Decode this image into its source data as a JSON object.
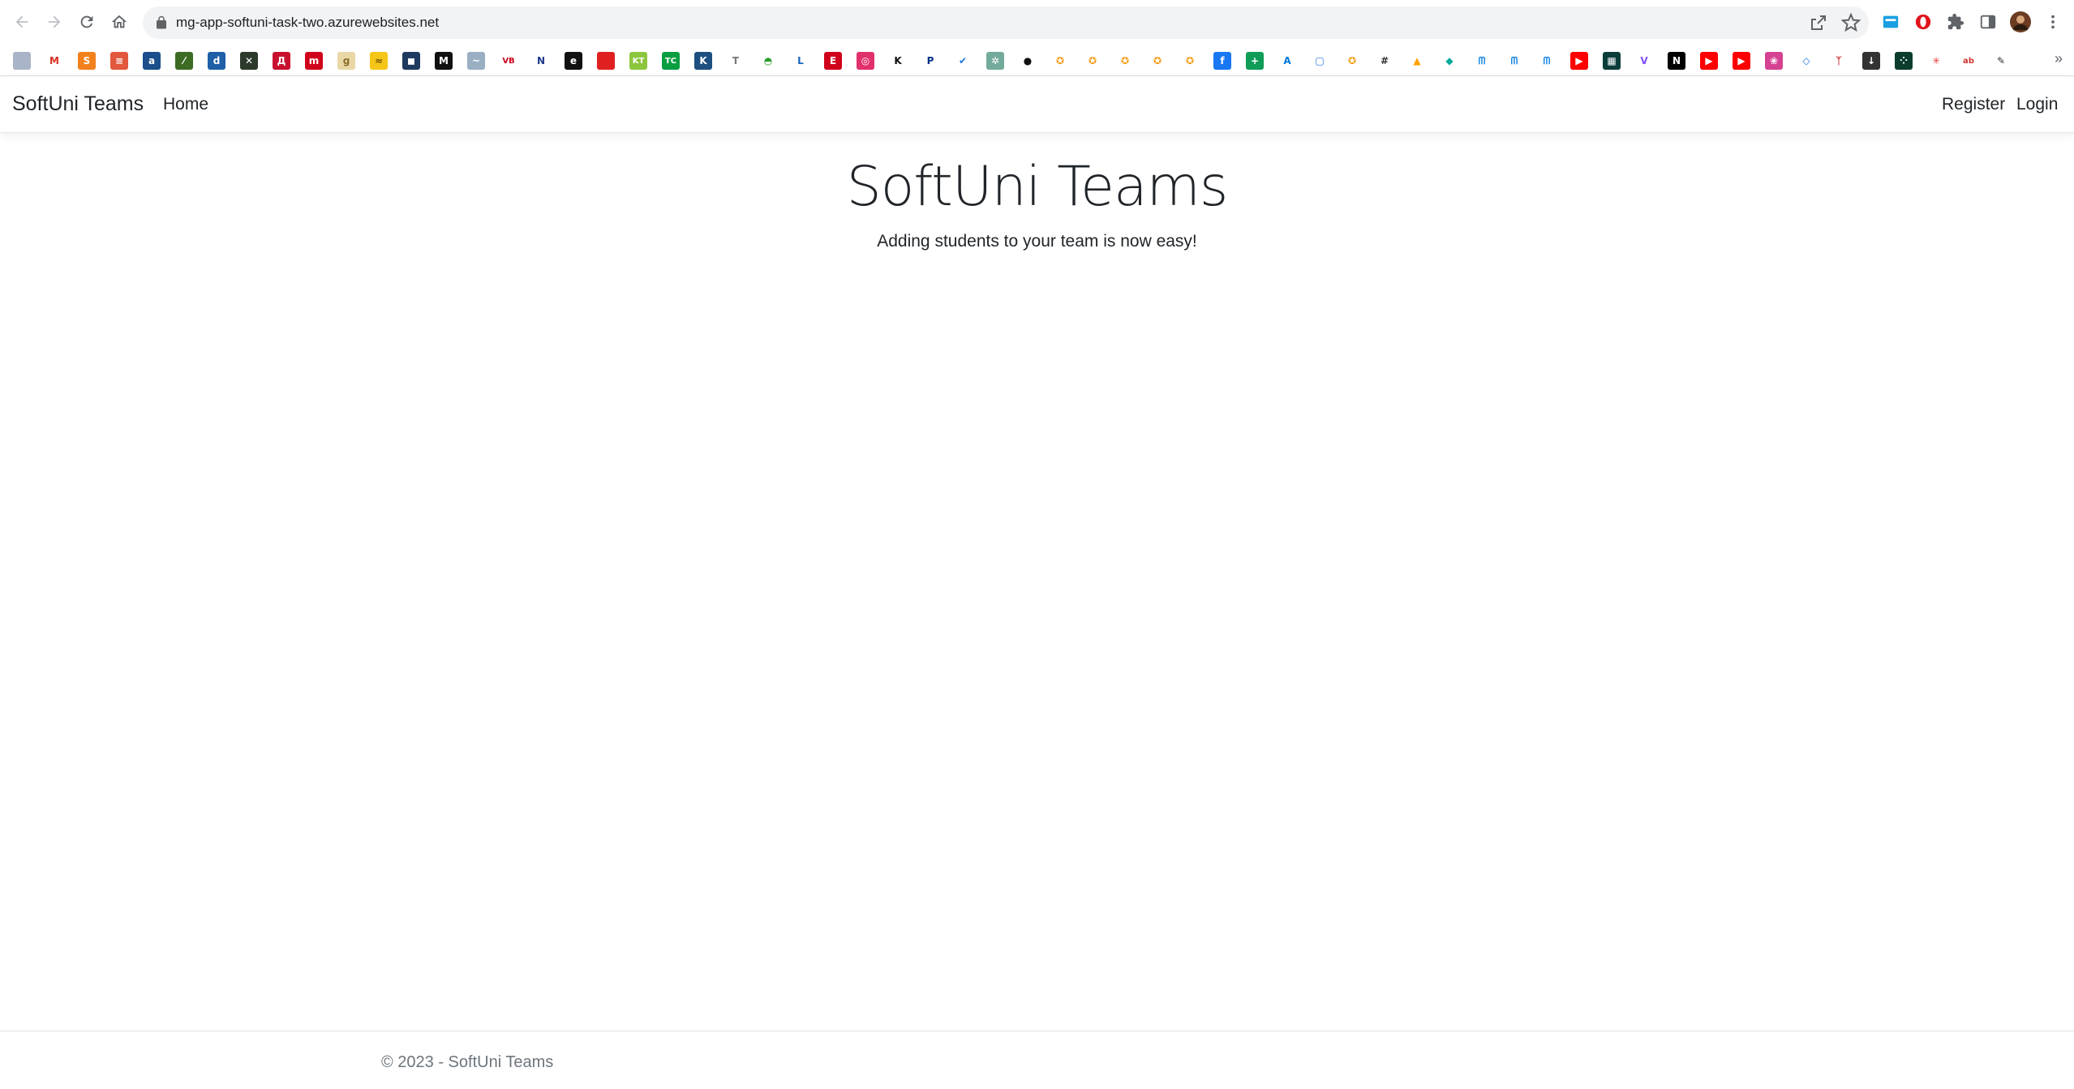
{
  "browser": {
    "url": "mg-app-softuni-task-two.azurewebsites.net",
    "bookmarks": [
      {
        "icon": "doc-icon",
        "color": "#aab4c8",
        "glyph": ""
      },
      {
        "icon": "gmail-icon",
        "color": "#ffffff",
        "glyph": "M"
      },
      {
        "icon": "orange-s-icon",
        "color": "#f2811d",
        "glyph": "S"
      },
      {
        "icon": "news-icon",
        "color": "#e2583e",
        "glyph": "≡"
      },
      {
        "icon": "a-icon",
        "color": "#1b4e8b",
        "glyph": "a"
      },
      {
        "icon": "leaf-icon",
        "color": "#3d6b24",
        "glyph": "⁄"
      },
      {
        "icon": "dir-icon",
        "color": "#1e5fa8",
        "glyph": "d"
      },
      {
        "icon": "x-circle-icon",
        "color": "#2b3a2b",
        "glyph": "✕"
      },
      {
        "icon": "red-book-icon",
        "color": "#c8102e",
        "glyph": "Д"
      },
      {
        "icon": "m-icon",
        "color": "#d0021b",
        "glyph": "m"
      },
      {
        "icon": "g-icon",
        "color": "#e9d8a6",
        "glyph": "g"
      },
      {
        "icon": "yellow-icon",
        "color": "#f5c518",
        "glyph": "≈"
      },
      {
        "icon": "dark-icon",
        "color": "#1e3a5f",
        "glyph": "◼"
      },
      {
        "icon": "jm-icon",
        "color": "#111111",
        "glyph": "M"
      },
      {
        "icon": "wave-icon",
        "color": "#9aaec4",
        "glyph": "~"
      },
      {
        "icon": "vb-icon",
        "color": "#ffffff",
        "glyph": "VB"
      },
      {
        "icon": "n-icon",
        "color": "#ffffff",
        "glyph": "N"
      },
      {
        "icon": "e-dark-icon",
        "color": "#111111",
        "glyph": "e"
      },
      {
        "icon": "red-square-icon",
        "color": "#e02020",
        "glyph": ""
      },
      {
        "icon": "kt-icon",
        "color": "#8cc63f",
        "glyph": "KT"
      },
      {
        "icon": "tc-icon",
        "color": "#0a9e41",
        "glyph": "TC"
      },
      {
        "icon": "k-icon",
        "color": "#1d4f80",
        "glyph": "K"
      },
      {
        "icon": "t-icon",
        "color": "#ffffff",
        "glyph": "T"
      },
      {
        "icon": "car-icon",
        "color": "#ffffff",
        "glyph": "◓"
      },
      {
        "icon": "l-icon",
        "color": "#ffffff",
        "glyph": "L"
      },
      {
        "icon": "e-red-icon",
        "color": "#d0021b",
        "glyph": "E"
      },
      {
        "icon": "instagram-icon",
        "color": "#e1306c",
        "glyph": "◎"
      },
      {
        "icon": "k-bold-icon",
        "color": "#ffffff",
        "glyph": "K"
      },
      {
        "icon": "paypal-icon",
        "color": "#ffffff",
        "glyph": "P"
      },
      {
        "icon": "check-icon",
        "color": "#ffffff",
        "glyph": "✔"
      },
      {
        "icon": "chatgpt-icon",
        "color": "#74aa9c",
        "glyph": "✲"
      },
      {
        "icon": "github-icon",
        "color": "#ffffff",
        "glyph": "●"
      },
      {
        "icon": "softuni-icon",
        "color": "#ffffff",
        "glyph": "✪"
      },
      {
        "icon": "softuni-icon",
        "color": "#ffffff",
        "glyph": "✪"
      },
      {
        "icon": "softuni-icon",
        "color": "#ffffff",
        "glyph": "✪"
      },
      {
        "icon": "softuni-icon",
        "color": "#ffffff",
        "glyph": "✪"
      },
      {
        "icon": "softuni-icon",
        "color": "#ffffff",
        "glyph": "✪"
      },
      {
        "icon": "facebook-icon",
        "color": "#1877f2",
        "glyph": "f"
      },
      {
        "icon": "sheets-icon",
        "color": "#0f9d58",
        "glyph": "+"
      },
      {
        "icon": "azure-icon",
        "color": "#ffffff",
        "glyph": "A"
      },
      {
        "icon": "frame-icon",
        "color": "#ffffff",
        "glyph": "▢"
      },
      {
        "icon": "softuni-icon",
        "color": "#ffffff",
        "glyph": "✪"
      },
      {
        "icon": "hash-icon",
        "color": "#ffffff",
        "glyph": "#"
      },
      {
        "icon": "firebase-icon",
        "color": "#ffffff",
        "glyph": "▲"
      },
      {
        "icon": "diamond-icon",
        "color": "#ffffff",
        "glyph": "◆"
      },
      {
        "icon": "mj-icon",
        "color": "#ffffff",
        "glyph": "ᗰ"
      },
      {
        "icon": "mj-icon",
        "color": "#ffffff",
        "glyph": "ᗰ"
      },
      {
        "icon": "mj-icon",
        "color": "#ffffff",
        "glyph": "ᗰ"
      },
      {
        "icon": "youtube-icon",
        "color": "#ff0000",
        "glyph": "▶"
      },
      {
        "icon": "grid-icon",
        "color": "#0b3d3a",
        "glyph": "▦"
      },
      {
        "icon": "vue-icon",
        "color": "#ffffff",
        "glyph": "V"
      },
      {
        "icon": "nextjs-icon",
        "color": "#000000",
        "glyph": "N"
      },
      {
        "icon": "youtube-icon",
        "color": "#ff0000",
        "glyph": "▶"
      },
      {
        "icon": "youtube-icon",
        "color": "#ff0000",
        "glyph": "▶"
      },
      {
        "icon": "swirl-icon",
        "color": "#d64292",
        "glyph": "❀"
      },
      {
        "icon": "diamond-outline-icon",
        "color": "#ffffff",
        "glyph": "◇"
      },
      {
        "icon": "tree-icon",
        "color": "#ffffff",
        "glyph": "ᛉ"
      },
      {
        "icon": "download-icon",
        "color": "#333333",
        "glyph": "↓"
      },
      {
        "icon": "dots-icon",
        "color": "#0b3d2e",
        "glyph": "⁘"
      },
      {
        "icon": "asterisk-icon",
        "color": "#ffffff",
        "glyph": "✳"
      },
      {
        "icon": "ab-icon",
        "color": "#ffffff",
        "glyph": "ab"
      },
      {
        "icon": "pencil-icon",
        "color": "#ffffff",
        "glyph": "✎"
      }
    ]
  },
  "navbar": {
    "brand": "SoftUni Teams",
    "links": [
      {
        "label": "Home"
      }
    ],
    "right_links": [
      {
        "label": "Register"
      },
      {
        "label": "Login"
      }
    ]
  },
  "hero": {
    "title": "SoftUni Teams",
    "subtitle": "Adding students to your team is now easy!"
  },
  "footer": {
    "text": "© 2023 - SoftUni Teams"
  }
}
